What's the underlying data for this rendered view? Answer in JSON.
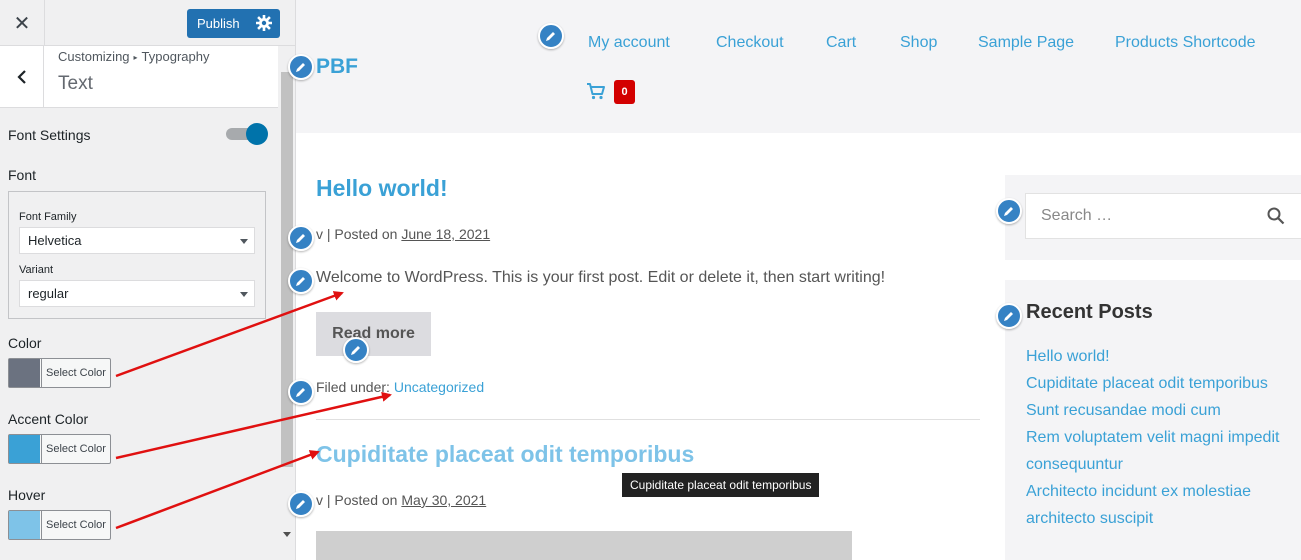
{
  "customizer": {
    "close_glyph": "✕",
    "publish_label": "Publish",
    "breadcrumb": {
      "root": "Customizing",
      "separator": "▸",
      "section": "Typography"
    },
    "section_title": "Text",
    "font_settings_label": "Font Settings",
    "font_settings_enabled": true,
    "font_label": "Font",
    "font_family_label": "Font Family",
    "font_family_value": "Helvetica",
    "variant_label": "Variant",
    "variant_value": "regular",
    "color_controls": [
      {
        "label": "Color",
        "button": "Select Color",
        "swatch": "#6b7280"
      },
      {
        "label": "Accent Color",
        "button": "Select Color",
        "swatch": "#3aa1d6"
      },
      {
        "label": "Hover",
        "button": "Select Color",
        "swatch": "#7ec3e8"
      }
    ]
  },
  "site": {
    "logo": "PBF",
    "nav": [
      "My account",
      "Checkout",
      "Cart",
      "Shop",
      "Sample Page",
      "Products Shortcode"
    ],
    "cart_count": "0",
    "posts": [
      {
        "title": "Hello world!",
        "author": "v",
        "posted_prefix": "| Posted on",
        "date": "June 18, 2021",
        "excerpt": "Welcome to WordPress. This is your first post. Edit or delete it, then start writing!",
        "read_more": "Read more",
        "filed_prefix": "Filed under:",
        "category": "Uncategorized"
      },
      {
        "title": "Cupiditate placeat odit temporibus",
        "author": "v",
        "posted_prefix": "| Posted on",
        "date": "May 30, 2021"
      }
    ],
    "tooltip": "Cupiditate placeat odit temporibus",
    "sidebar": {
      "search_placeholder": "Search …",
      "recent_title": "Recent Posts",
      "recent_items": [
        "Hello world!",
        "Cupiditate placeat odit temporibus",
        "Sunt recusandae modi cum",
        "Rem voluptatem velit magni impedit",
        "consequuntur",
        "Architecto incidunt ex molestiae",
        "architecto suscipit"
      ]
    }
  },
  "colors": {
    "accent": "#3aa1d6",
    "publish": "#2271b1",
    "edit_pen": "#3582c4",
    "annotation_arrow": "#e01010",
    "cart_badge": "#d30000"
  }
}
